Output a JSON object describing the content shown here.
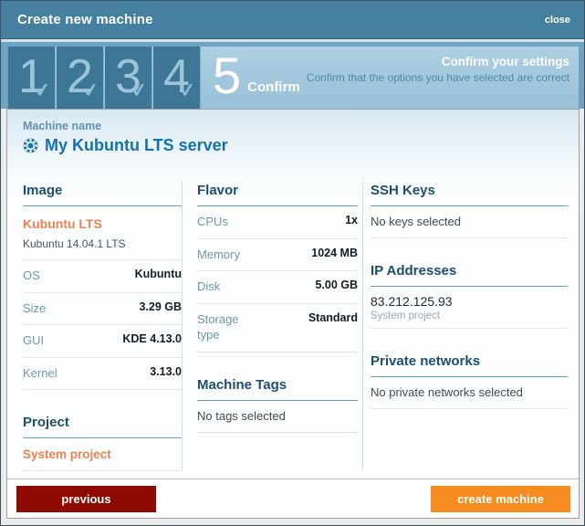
{
  "window": {
    "title": "Create new machine",
    "close_label": "close"
  },
  "wizard": {
    "steps": [
      "1",
      "2",
      "3",
      "4"
    ],
    "active_step": {
      "number": "5",
      "label": "Confirm"
    },
    "heading": "Confirm your settings",
    "subheading": "Confirm that the options you have selected are correct"
  },
  "machine": {
    "name_label": "Machine name",
    "name": "My Kubuntu LTS server",
    "icon": "kubuntu-logo"
  },
  "image": {
    "title": "Image",
    "name": "Kubuntu LTS",
    "description": "Kubuntu 14.04.1 LTS",
    "rows": [
      {
        "label": "OS",
        "value": "Kubuntu"
      },
      {
        "label": "Size",
        "value": "3.29 GB"
      },
      {
        "label": "GUI",
        "value": "KDE 4.13.0"
      },
      {
        "label": "Kernel",
        "value": "3.13.0"
      }
    ]
  },
  "project": {
    "title": "Project",
    "value": "System project"
  },
  "flavor": {
    "title": "Flavor",
    "rows": [
      {
        "label": "CPUs",
        "value": "1x"
      },
      {
        "label": "Memory",
        "value": "1024 MB"
      },
      {
        "label": "Disk",
        "value": "5.00 GB"
      },
      {
        "label": "Storage type",
        "value": "Standard"
      }
    ]
  },
  "machine_tags": {
    "title": "Machine Tags",
    "empty": "No tags selected"
  },
  "ssh_keys": {
    "title": "SSH Keys",
    "empty": "No keys selected"
  },
  "ip_addresses": {
    "title": "IP Addresses",
    "address": "83.212.125.93",
    "project": "System project"
  },
  "private_networks": {
    "title": "Private networks",
    "empty": "No private networks selected"
  },
  "footer": {
    "previous_label": "previous",
    "create_label": "create machine"
  },
  "colors": {
    "titlebar": "#45809f",
    "wizard_frame": "#6fa3c1",
    "step_box": "#3e7795",
    "step_bar": "#a9cbdf",
    "section_header": "#1d4f6e",
    "accent_orange": "#f0814e",
    "button_orange": "#f68b1f",
    "button_red": "#8e0b04",
    "machine_title_blue": "#1273ad"
  }
}
